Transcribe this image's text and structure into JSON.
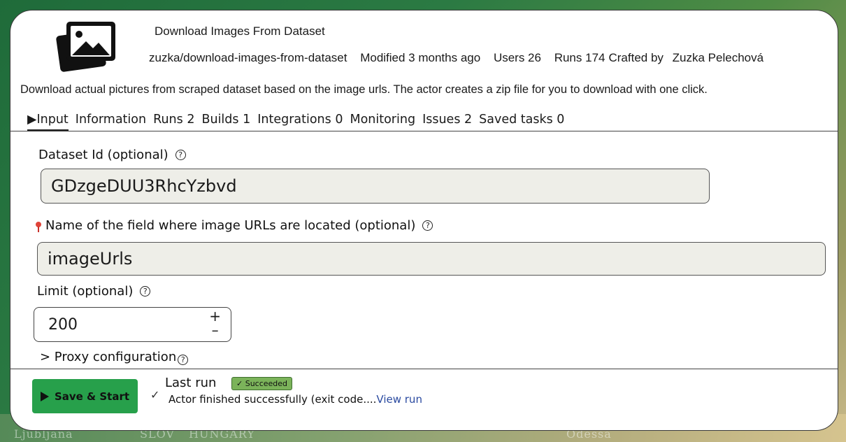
{
  "actor": {
    "title": "Download Images From Dataset",
    "slug": "zuzka/download-images-from-dataset",
    "modified": "Modified 3 months ago",
    "users": "Users 26",
    "runs": "Runs 174",
    "crafted_by_label": "Crafted by",
    "author": "Zuzka Pelechová",
    "description": "Download actual pictures from scraped dataset based on the image urls. The actor creates a zip file for you to download with one click."
  },
  "tabs": [
    {
      "label": "▶Input"
    },
    {
      "label": "Information"
    },
    {
      "label": "Runs 2"
    },
    {
      "label": "Builds 1"
    },
    {
      "label": "Integrations 0"
    },
    {
      "label": "Monitoring"
    },
    {
      "label": "Issues 2"
    },
    {
      "label": "Saved tasks 0"
    }
  ],
  "form": {
    "dataset_id": {
      "label": "Dataset Id (optional)",
      "value": "GDzgeDUU3RhcYzbvd"
    },
    "field_name": {
      "label": "Name of the field where image URLs are located (optional)",
      "value": "imageUrls"
    },
    "limit": {
      "label": "Limit  (optional)",
      "value": "200",
      "plus": "+",
      "minus": "–"
    },
    "proxy": {
      "label": "> Proxy configuration"
    },
    "help_glyph": "?"
  },
  "footer": {
    "save_label": "Save & Start",
    "last_run_label": "Last run",
    "status": "✓ Succeeded",
    "status_color": "#7bb35a",
    "run_message": "Actor finished successfully (exit code....",
    "view_run": "View run"
  },
  "background": {
    "map_labels": [
      "Ljubljana",
      "SLOV",
      "HUNGARY",
      "Odessa"
    ]
  },
  "colors": {
    "accent": "#27a04b",
    "link": "#2a4aa0"
  }
}
